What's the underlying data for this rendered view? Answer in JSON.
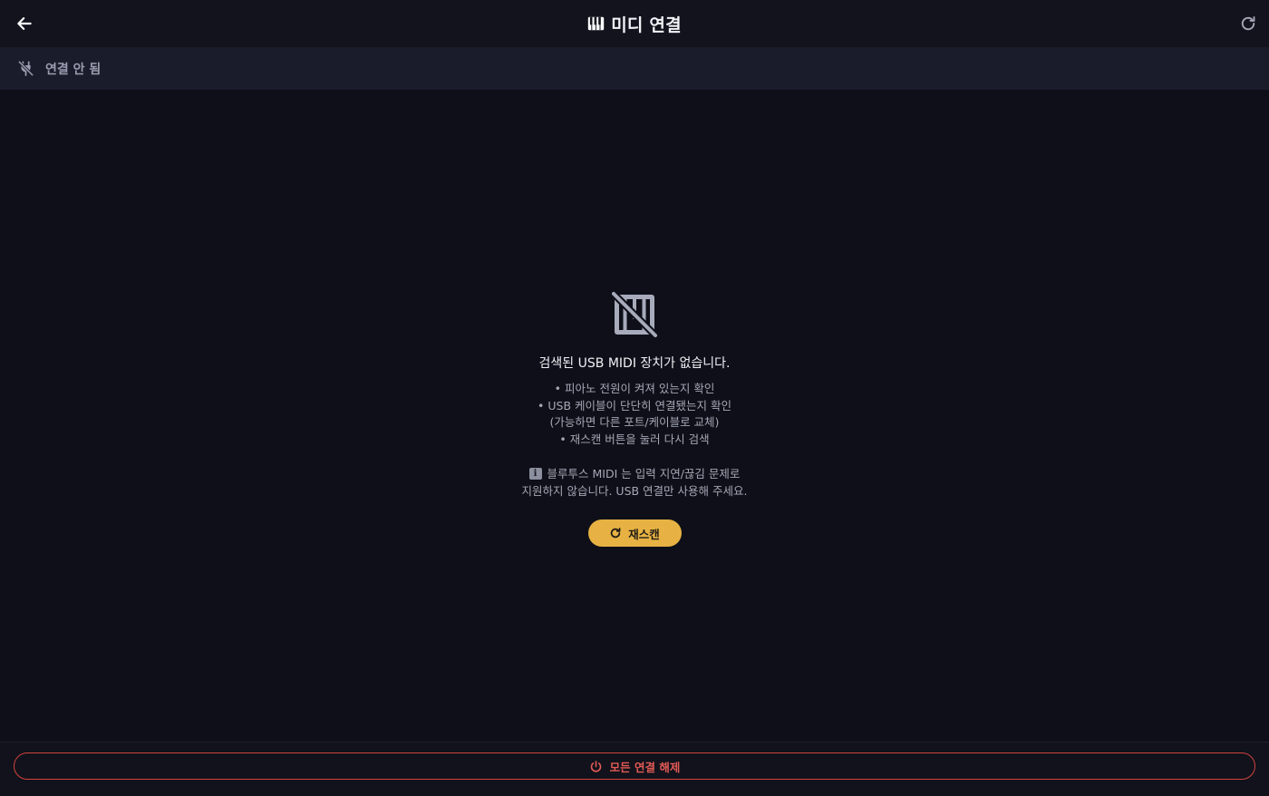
{
  "header": {
    "title": "미디 연결",
    "back_icon": "arrow-left-icon",
    "title_icon": "piano-icon",
    "refresh_icon": "refresh-icon"
  },
  "status": {
    "text": "연결 안 됨",
    "icon": "plug-off-icon"
  },
  "empty_state": {
    "icon": "piano-off-icon",
    "title": "검색된 USB MIDI 장치가 없습니다.",
    "tips": [
      "• 피아노 전원이 켜져 있는지 확인",
      "• USB 케이블이 단단히 연결됐는지 확인",
      "(가능하면 다른 포트/케이블로 교체)",
      "• 재스캔 버튼을 눌러 다시 검색"
    ],
    "notice_badge": "i",
    "notice_line1": "블루투스 MIDI 는 입력 지연/끊김 문제로",
    "notice_line2": "지원하지 않습니다. USB 연결만 사용해 주세요.",
    "rescan_label": "재스캔"
  },
  "footer": {
    "disconnect_label": "모든 연결 해제",
    "disconnect_icon": "power-icon"
  },
  "colors": {
    "background": "#0e0f18",
    "header_bg": "#12131d",
    "status_bg": "#1b1c2b",
    "accent": "#e7b243",
    "danger": "#d2433f"
  }
}
